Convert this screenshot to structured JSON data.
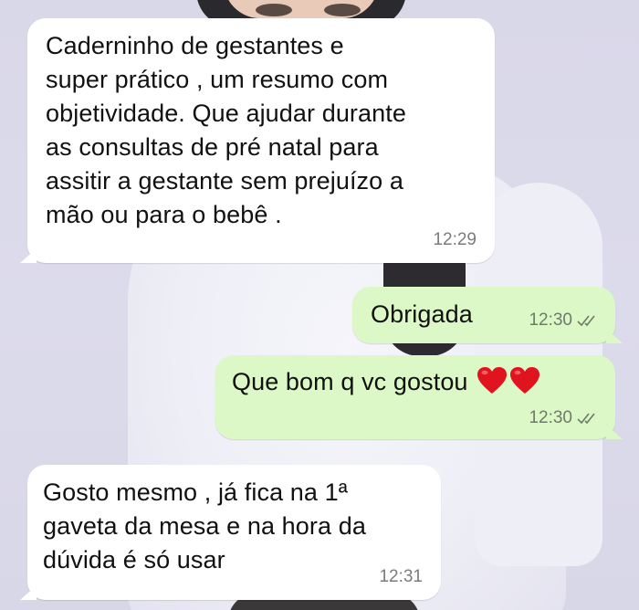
{
  "messages": [
    {
      "direction": "incoming",
      "text": "Caderninho de gestantes  e\nsuper prático , um resumo com\nobjetividade. Que ajudar durante\nas consultas de pré natal para\nassitir a gestante sem prejuízo a\nmão ou para o bebê .",
      "time": "12:29"
    },
    {
      "direction": "outgoing",
      "text": "Obrigada",
      "time": "12:30",
      "status_icon": "double-check-icon"
    },
    {
      "direction": "outgoing",
      "text": "Que bom q vc gostou",
      "emoji": [
        "red-heart-icon",
        "red-heart-icon"
      ],
      "time": "12:30",
      "status_icon": "double-check-icon"
    },
    {
      "direction": "incoming",
      "text": "Gosto mesmo , já fica na 1ª\ngaveta da mesa e na hora da\ndúvida é só usar",
      "time": "12:31"
    }
  ],
  "colors": {
    "incoming_bubble": "#ffffff",
    "outgoing_bubble": "#dcf8c6",
    "timestamp": "#7b7b7b",
    "heart": "#e0141e"
  }
}
